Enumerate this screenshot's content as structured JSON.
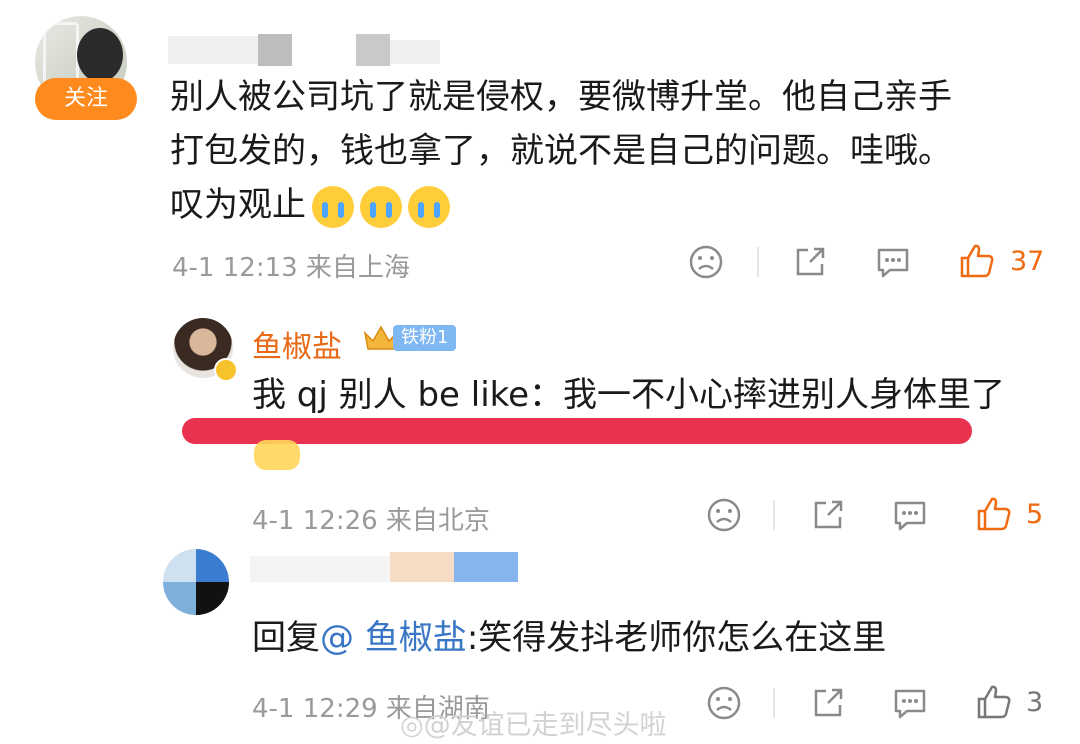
{
  "comment1": {
    "follow_label": "关注",
    "text_line1": "别人被公司坑了就是侵权，要微博升堂。他自己亲手",
    "text_line2": "打包发的，钱也拿了，就说不是自己的问题。哇哦。",
    "text_line3": "叹为观止",
    "emoji_icons": [
      "crying-face-icon",
      "crying-face-icon",
      "crying-face-icon"
    ],
    "meta": "4-1 12:13 来自上海",
    "likes": "37"
  },
  "reply1": {
    "username": "鱼椒盐",
    "fan_badge": "铁粉1",
    "text": "我 qj 别人 be like：我一不小心摔进别人身体里了",
    "meta": "4-1 12:26 来自北京",
    "likes": "5"
  },
  "reply2": {
    "reply_prefix": "回复",
    "mention": "@ 鱼椒盐",
    "text": ":笑得发抖老师你怎么在这里",
    "meta": "4-1 12:29 来自湖南",
    "likes": "3"
  },
  "watermark": "@友谊已走到尽头啦",
  "colors": {
    "accent": "#ff8a1e",
    "like_orange": "#f06a10",
    "highlight": "#e8324f",
    "mention": "#3977c6"
  }
}
